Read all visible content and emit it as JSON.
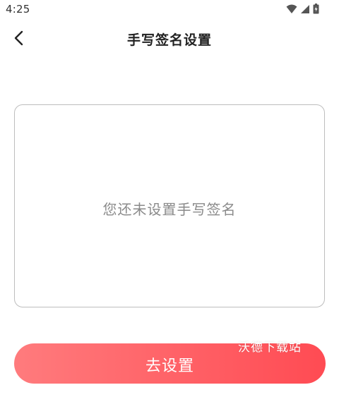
{
  "status_bar": {
    "time": "4:25",
    "icons": [
      "wifi-icon",
      "signal-icon",
      "battery-icon"
    ]
  },
  "header": {
    "title": "手写签名设置",
    "back_icon": "chevron-left-icon"
  },
  "signature": {
    "placeholder": "您还未设置手写签名"
  },
  "actions": {
    "setup_label": "去设置"
  },
  "watermark": {
    "text": "沃德下载站"
  },
  "colors": {
    "button_gradient_start": "#ff7b7d",
    "button_gradient_end": "#ff4b53",
    "placeholder_text": "#8a8a8a",
    "border": "#bdbdbd"
  }
}
